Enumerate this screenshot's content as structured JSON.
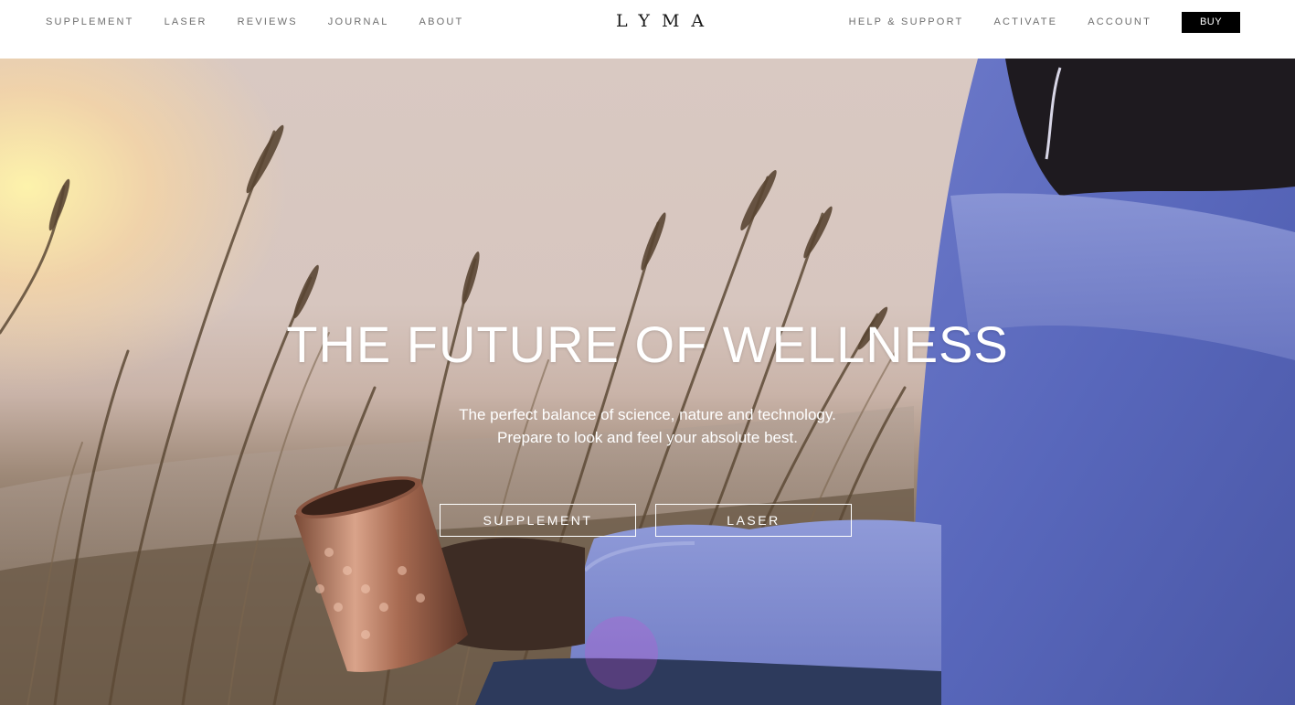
{
  "header": {
    "logo": "LYMA",
    "nav_left": [
      {
        "label": "SUPPLEMENT"
      },
      {
        "label": "LASER"
      },
      {
        "label": "REVIEWS"
      },
      {
        "label": "JOURNAL"
      },
      {
        "label": "ABOUT"
      }
    ],
    "nav_right": [
      {
        "label": "HELP & SUPPORT"
      },
      {
        "label": "ACTIVATE"
      },
      {
        "label": "ACCOUNT"
      }
    ],
    "buy_label": "BUY"
  },
  "hero": {
    "title": "THE FUTURE OF WELLNESS",
    "subtitle_line1": "The perfect balance of science, nature and technology.",
    "subtitle_line2": "Prepare to look and feel your absolute best.",
    "cta_supplement": "SUPPLEMENT",
    "cta_laser": "LASER"
  },
  "colors": {
    "buy_bg": "#000000",
    "nav_text": "#6e6e6e",
    "hero_text": "#ffffff"
  }
}
